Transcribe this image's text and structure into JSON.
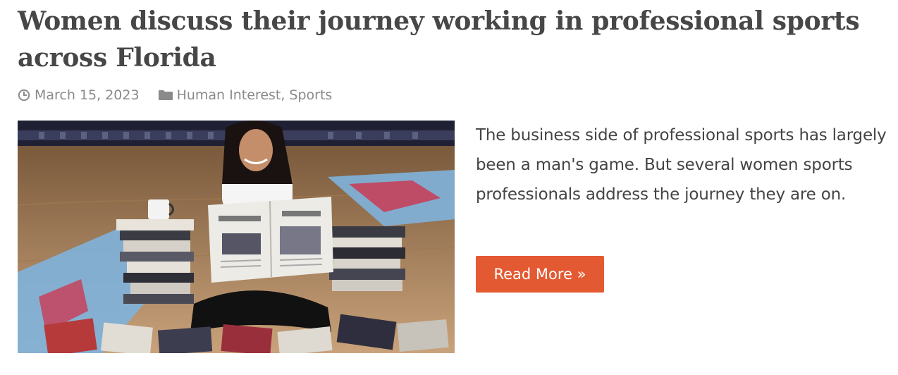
{
  "post": {
    "title": "Women discuss their journey working in professional sports across Florida",
    "date": "March 15, 2023",
    "categories": [
      "Human Interest",
      "Sports"
    ],
    "category_separator": ",",
    "excerpt": "The business side of professional sports has largely been a man's game. But several women sports professionals address the journey they are on.",
    "read_more_label": "Read More »"
  },
  "icons": {
    "date": "clock-icon",
    "categories": "folder-icon"
  },
  "colors": {
    "title": "#474747",
    "meta": "#8a8a8a",
    "body_text": "#444444",
    "button": "#e35a32",
    "button_text": "#ffffff"
  }
}
